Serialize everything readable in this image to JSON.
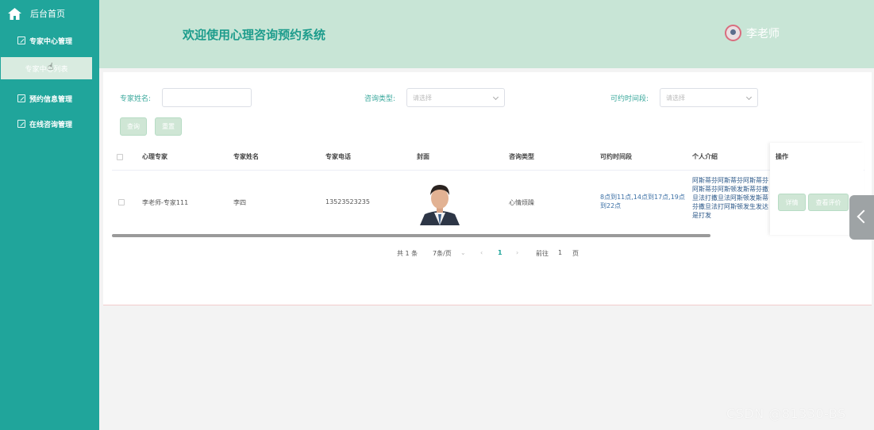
{
  "sidebar": {
    "home_label": "后台首页",
    "menu1_label": "专家中心管理",
    "submenu_label": "专家中心列表",
    "menu2_label": "预约信息管理",
    "menu3_label": "在线咨询管理"
  },
  "header": {
    "title": "欢迎使用心理咨询预约系统",
    "user_name": "李老师"
  },
  "filters": {
    "expert_name_label": "专家姓名:",
    "expert_name_value": "",
    "consult_type_label": "咨询类型:",
    "consult_type_placeholder": "请选择",
    "time_label": "可约时间段:",
    "time_placeholder": "请选择",
    "query_button": "查询",
    "reset_button": "重置"
  },
  "table": {
    "headers": [
      "心理专家",
      "专家姓名",
      "专家电话",
      "封面",
      "咨询类型",
      "可约时间段",
      "个人介绍"
    ],
    "op_header": "操作",
    "rows": [
      {
        "expert": "李老师-专家111",
        "name": "李四",
        "phone": "13523523235",
        "type": "心情烦躁",
        "time": "8点到11点,14点到17点,19点到22点",
        "intro": "阿斯蒂芬阿斯蒂芬阿斯蒂芬阿斯蒂芬阿斯顿发斯蒂芬撒旦法打撒旦法阿斯顿发斯蒂芬撒旦法打阿斯顿发生发达是打发",
        "detail_button": "详情",
        "review_button": "查看评价"
      }
    ]
  },
  "pagination": {
    "total": "共 1 条",
    "page_size": "7条/页",
    "current_page": "1",
    "goto_label": "前往",
    "goto_value": "1",
    "page_suffix": "页"
  },
  "watermark": "CSDN @81330-BS"
}
